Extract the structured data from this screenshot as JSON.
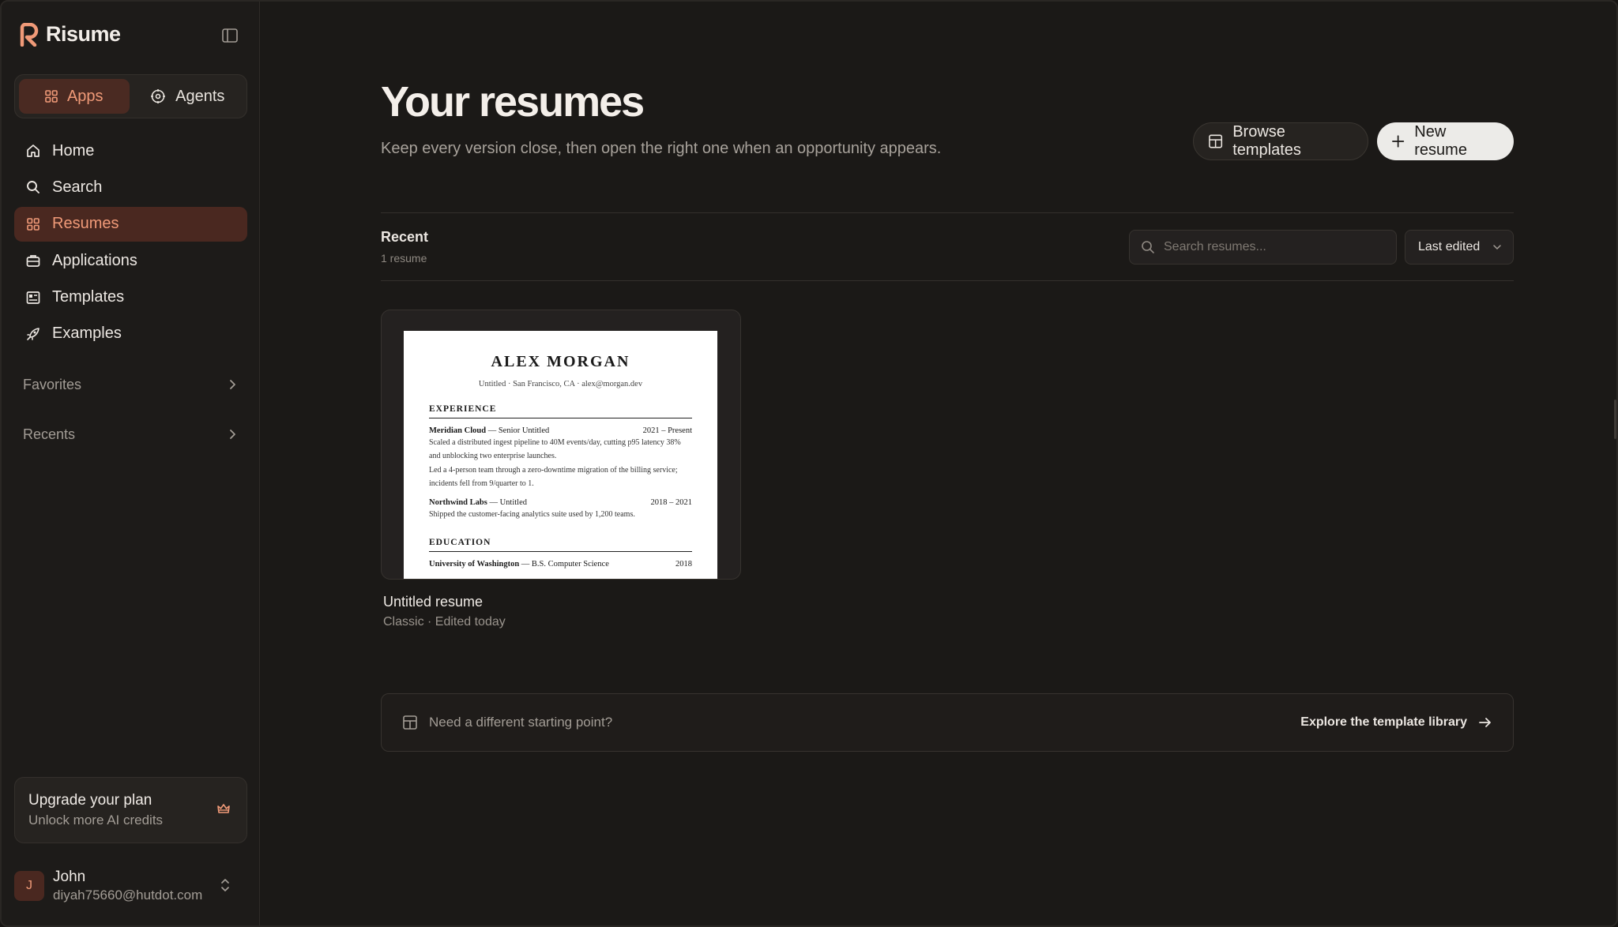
{
  "app": {
    "name": "Risume"
  },
  "switcher": {
    "apps_label": "Apps",
    "agents_label": "Agents"
  },
  "nav": {
    "items": [
      {
        "label": "Home",
        "icon": "home-icon"
      },
      {
        "label": "Search",
        "icon": "search-icon"
      },
      {
        "label": "Resumes",
        "icon": "grid-icon",
        "active": true
      },
      {
        "label": "Applications",
        "icon": "briefcase-icon"
      },
      {
        "label": "Templates",
        "icon": "template-icon"
      },
      {
        "label": "Examples",
        "icon": "rocket-icon"
      }
    ]
  },
  "sections": {
    "favorites": "Favorites",
    "recents": "Recents"
  },
  "upgrade": {
    "title": "Upgrade your plan",
    "subtitle": "Unlock more AI credits"
  },
  "user": {
    "initial": "J",
    "name": "John",
    "email": "diyah75660@hutdot.com"
  },
  "header": {
    "title": "Your resumes",
    "subtitle": "Keep every version close, then open the right one when an opportunity appears.",
    "browse_label": "Browse templates",
    "new_label": "New resume"
  },
  "list": {
    "title": "Recent",
    "count": "1 resume",
    "search_placeholder": "Search resumes...",
    "sort_value": "Last edited"
  },
  "resumes": [
    {
      "title": "Untitled resume",
      "meta": "Classic · Edited today",
      "preview": {
        "name": "ALEX MORGAN",
        "contact": "Untitled · San Francisco, CA · alex@morgan.dev",
        "experience_heading": "EXPERIENCE",
        "job1_company": "Meridian Cloud",
        "job1_role": " — Senior Untitled",
        "job1_dates": "2021 – Present",
        "job1_text1": "Scaled a distributed ingest pipeline to 40M events/day, cutting p95 latency 38% and unblocking two enterprise launches.",
        "job1_text2": "Led a 4-person team through a zero-downtime migration of the billing service; incidents fell from 9/quarter to 1.",
        "job2_company": "Northwind Labs",
        "job2_role": " — Untitled",
        "job2_dates": "2018 – 2021",
        "job2_text1": "Shipped the customer-facing analytics suite used by 1,200 teams.",
        "education_heading": "EDUCATION",
        "edu_school": "University of Washington",
        "edu_degree": " — B.S. Computer Science",
        "edu_year": "2018"
      }
    }
  ],
  "cta": {
    "text": "Need a different starting point?",
    "link": "Explore the template library"
  },
  "colors": {
    "accent": "#f09a78",
    "accent_bg": "#4a2820",
    "background": "#1b1917",
    "sidebar": "#1d1b19"
  }
}
